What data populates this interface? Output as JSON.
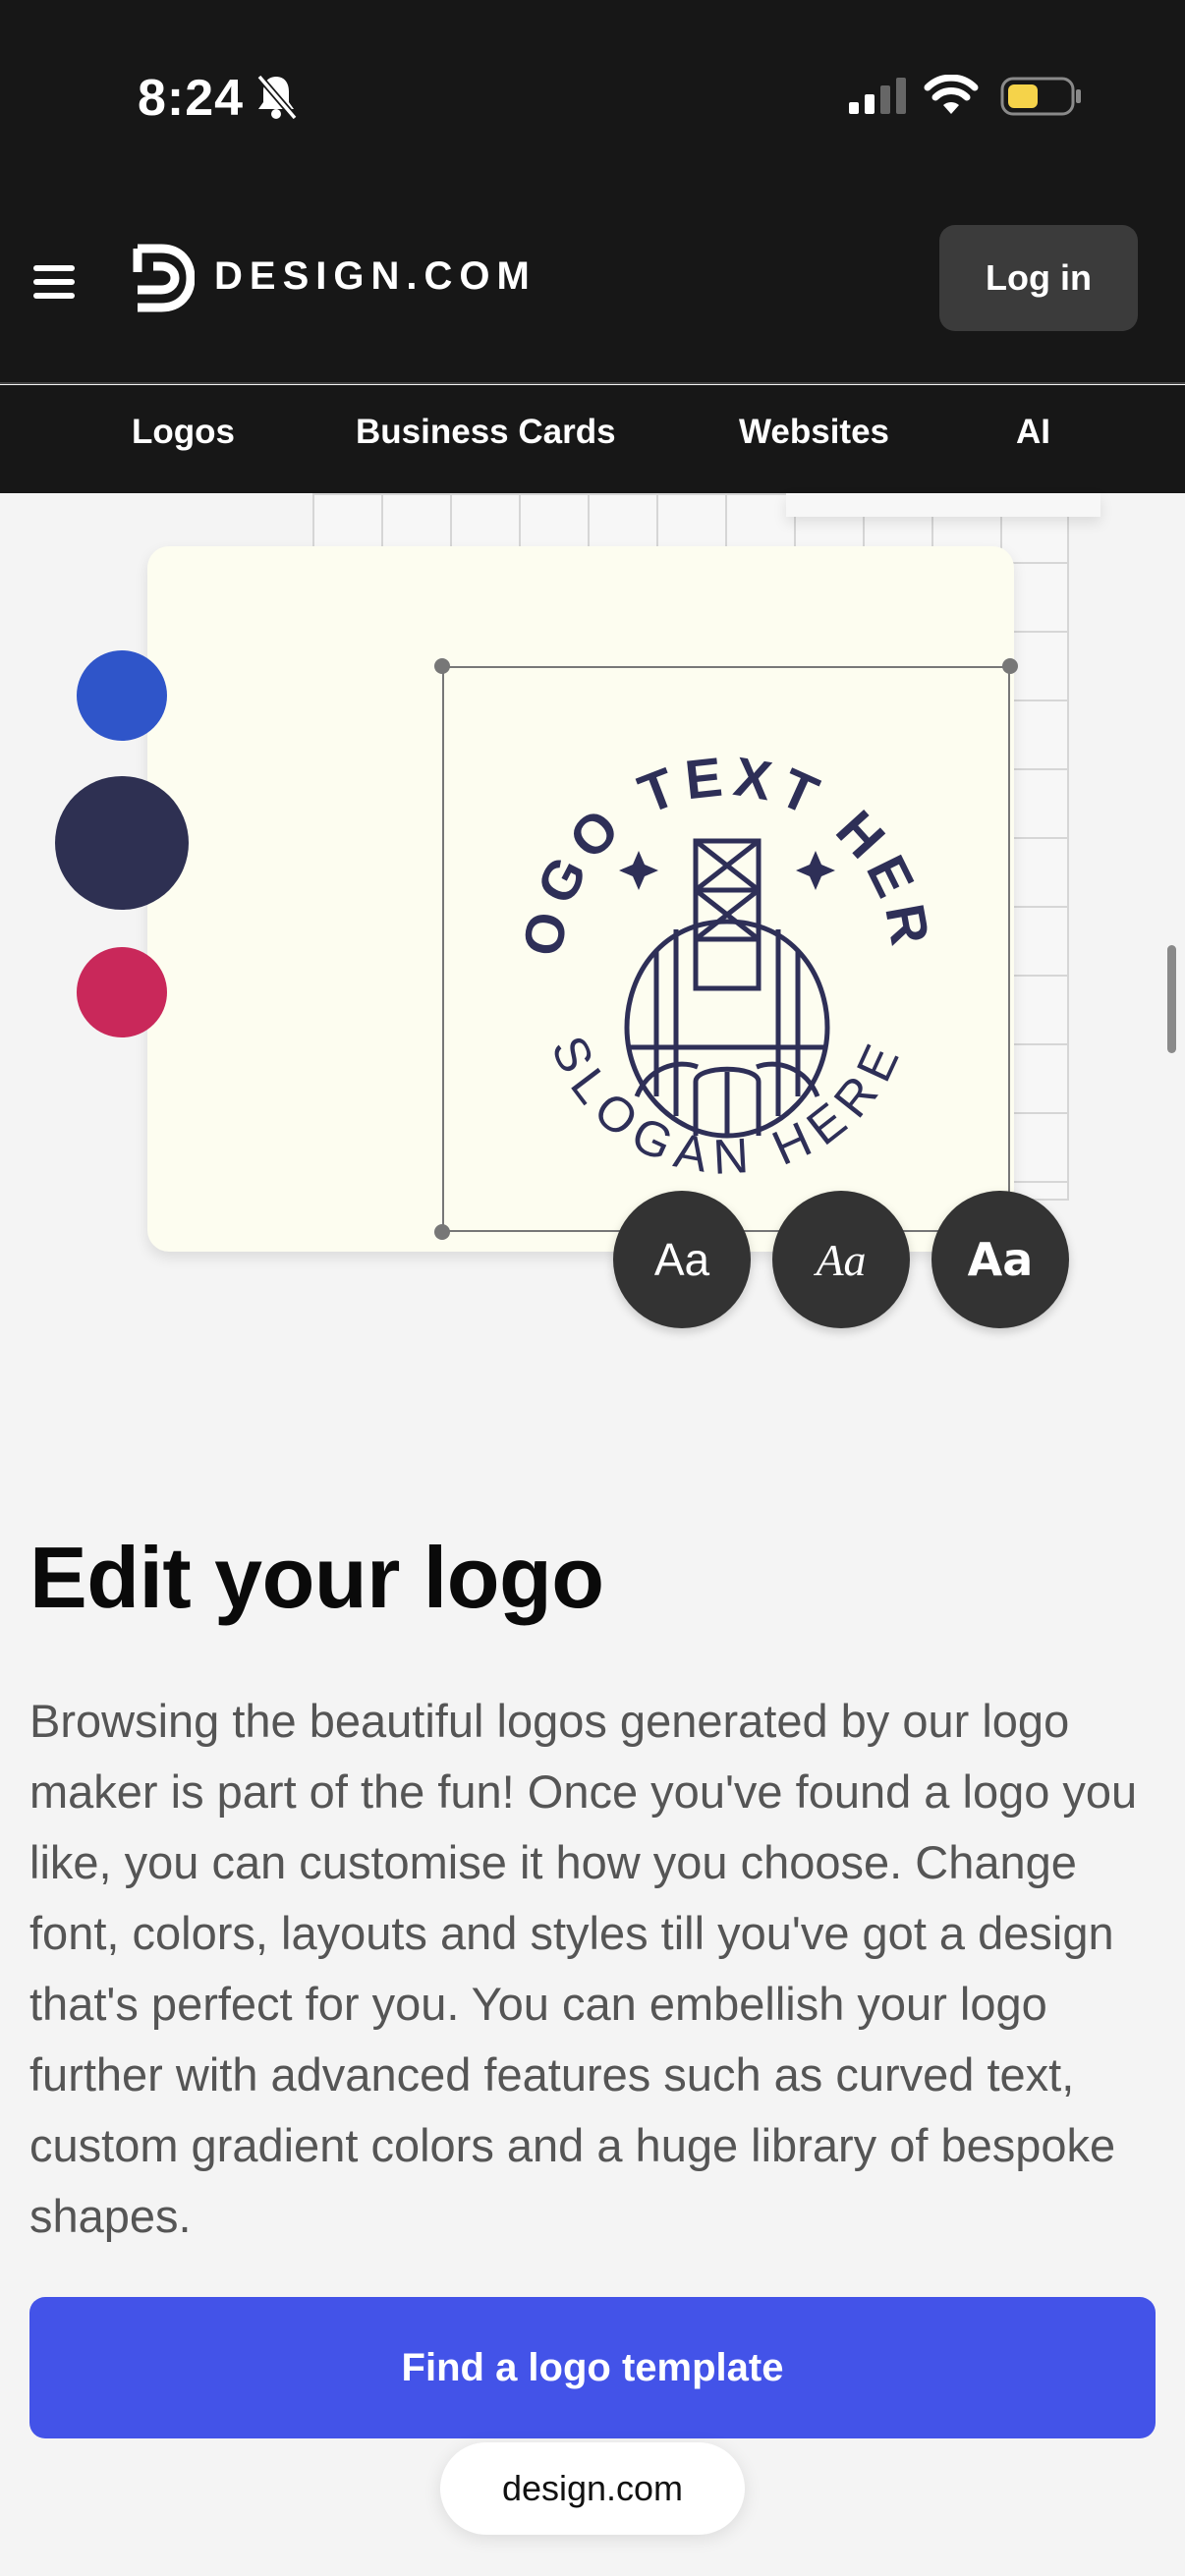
{
  "status": {
    "time": "8:24",
    "battery_color": "#f5d34a"
  },
  "header": {
    "brand": "DESIGN.COM",
    "login_label": "Log in"
  },
  "nav": {
    "items": [
      "Logos",
      "Business Cards",
      "Websites",
      "AI"
    ]
  },
  "illustration": {
    "logo_text_top": "LOGO TEXT HERE",
    "logo_text_bottom": "SLOGAN HERE",
    "logo_color": "#2e2f57",
    "swatches": [
      "#2f55c9",
      "#2e3052",
      "#c9285a"
    ],
    "font_buttons": [
      "Aa",
      "Aa",
      "Aa"
    ]
  },
  "main": {
    "heading": "Edit your logo",
    "body": "Browsing the beautiful logos generated by our logo maker is part of the fun! Once you've found a logo you like, you can customise it how you choose. Change font, colors, layouts and styles till you've got a design that's perfect for you. You can embellish your logo further with advanced features such as curved text, custom gradient colors and a huge library of bespoke shapes.",
    "cta_label": "Find a logo template"
  },
  "browser": {
    "url": "design.com"
  },
  "accent_color": "#4353e8"
}
